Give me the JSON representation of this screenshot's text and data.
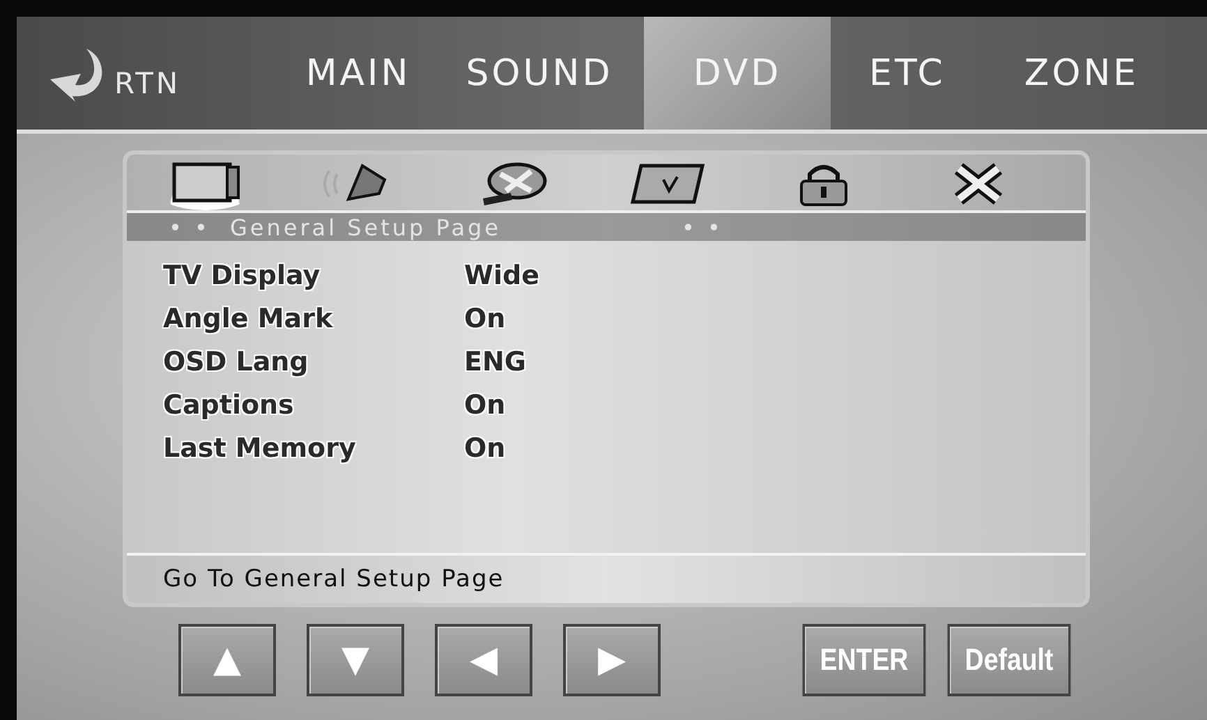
{
  "nav": {
    "back_label": "RTN",
    "tabs": [
      {
        "label": "MAIN",
        "selected": false
      },
      {
        "label": "SOUND",
        "selected": false
      },
      {
        "label": "DVD",
        "selected": true
      },
      {
        "label": "ETC",
        "selected": false
      },
      {
        "label": "ZONE",
        "selected": false
      }
    ]
  },
  "setup_icons": [
    {
      "kind": "tv",
      "selected": true
    },
    {
      "kind": "speaker",
      "selected": false
    },
    {
      "kind": "film",
      "selected": false
    },
    {
      "kind": "panel",
      "selected": false
    },
    {
      "kind": "lock",
      "selected": false
    },
    {
      "kind": "close",
      "selected": false
    }
  ],
  "page_heading": {
    "left_dots": "• •",
    "title": "General Setup Page",
    "right_dots": "• •"
  },
  "settings": [
    {
      "label": "TV Display",
      "value": "Wide"
    },
    {
      "label": "Angle Mark",
      "value": "On"
    },
    {
      "label": "OSD Lang",
      "value": "ENG"
    },
    {
      "label": "Captions",
      "value": "On"
    },
    {
      "label": "Last Memory",
      "value": "On"
    }
  ],
  "hint": "Go To General Setup Page",
  "arrow_buttons": [
    "▲",
    "▼",
    "◀",
    "▶"
  ],
  "action_buttons": [
    "ENTER",
    "Default"
  ]
}
